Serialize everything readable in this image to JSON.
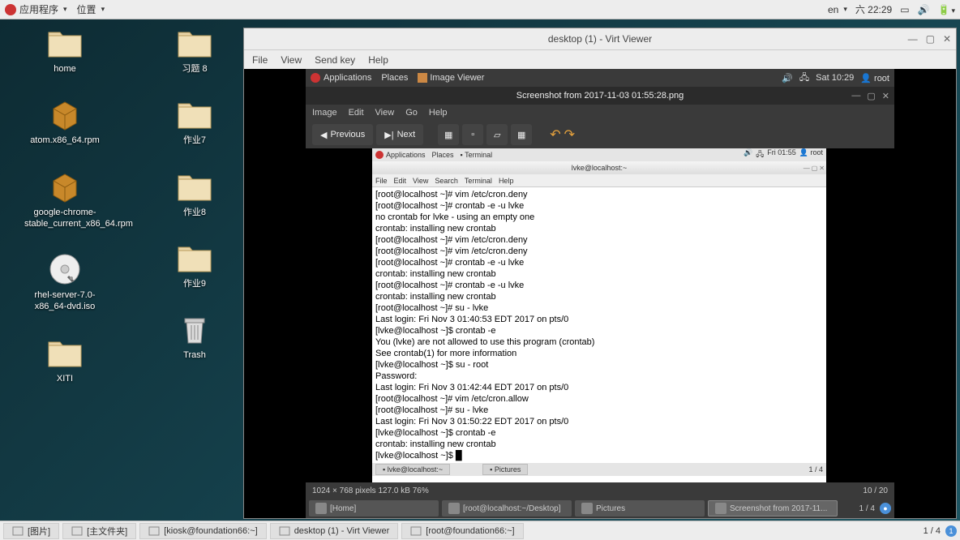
{
  "topbar": {
    "apps": "应用程序",
    "places": "位置",
    "lang": "en",
    "daytime": "六 22:29"
  },
  "desktop_icons": {
    "col1": [
      {
        "label": "home",
        "type": "folder"
      },
      {
        "label": "atom.x86_64.rpm",
        "type": "pkg"
      },
      {
        "label": "google-chrome-stable_current_x86_64.rpm",
        "type": "pkg"
      },
      {
        "label": "rhel-server-7.0-x86_64-dvd.iso",
        "type": "disc"
      },
      {
        "label": "XITI",
        "type": "folder"
      }
    ],
    "col2": [
      {
        "label": "习题  8",
        "type": "folder"
      },
      {
        "label": "作业7",
        "type": "folder"
      },
      {
        "label": "作业8",
        "type": "folder"
      },
      {
        "label": "作业9",
        "type": "folder"
      },
      {
        "label": "Trash",
        "type": "trash"
      }
    ]
  },
  "virt": {
    "title": "desktop (1) - Virt Viewer",
    "menu": [
      "File",
      "View",
      "Send key",
      "Help"
    ]
  },
  "inner": {
    "top": {
      "apps": "Applications",
      "places": "Places",
      "iv": "Image Viewer",
      "time": "Sat 10:29",
      "user": "root"
    },
    "img_title": "Screenshot from 2017-11-03 01:55:28.png",
    "img_menu": [
      "Image",
      "Edit",
      "View",
      "Go",
      "Help"
    ],
    "prev": "Previous",
    "next": "Next",
    "innermost": {
      "top": {
        "apps": "Applications",
        "places": "Places",
        "term": "Terminal",
        "time": "Fri 01:55",
        "user": "root"
      },
      "title": "lvke@localhost:~",
      "menu": [
        "File",
        "Edit",
        "View",
        "Search",
        "Terminal",
        "Help"
      ],
      "term_lines": [
        "[root@localhost ~]# vim /etc/cron.deny",
        "[root@localhost ~]# crontab -e -u lvke",
        "no crontab for lvke - using an empty one",
        "crontab: installing new crontab",
        "[root@localhost ~]# vim /etc/cron.deny",
        "[root@localhost ~]# vim /etc/cron.deny",
        "[root@localhost ~]# crontab -e -u lvke",
        "crontab: installing new crontab",
        "[root@localhost ~]# crontab -e -u lvke",
        "crontab: installing new crontab",
        "[root@localhost ~]# su - lvke",
        "Last login: Fri Nov  3 01:40:53 EDT 2017 on pts/0",
        "[lvke@localhost ~]$ crontab -e",
        "You (lvke) are not allowed to use this program (crontab)",
        "See crontab(1) for more information",
        "[lvke@localhost ~]$ su - root",
        "Password:",
        "Last login: Fri Nov  3 01:42:44 EDT 2017 on pts/0",
        "[root@localhost ~]# vim /etc/cron.allow",
        "[root@localhost ~]# su - lvke",
        "Last login: Fri Nov  3 01:50:22 EDT 2017 on pts/0",
        "[lvke@localhost ~]$ crontab -e",
        "crontab: installing new crontab",
        "[lvke@localhost ~]$ █"
      ],
      "taskbar": {
        "t1": "lvke@localhost:~",
        "t2": "Pictures",
        "counter": "1 / 4"
      }
    },
    "status": {
      "left": "1024 × 768 pixels   127.0 kB   76%",
      "right": "10 / 20"
    },
    "taskbar": [
      {
        "label": "[Home]"
      },
      {
        "label": "[root@localhost:~/Desktop]"
      },
      {
        "label": "Pictures"
      },
      {
        "label": "Screenshot from 2017-11...",
        "active": true
      }
    ],
    "taskbar_counter": "1 / 4"
  },
  "bottom": [
    {
      "label": "[图片]"
    },
    {
      "label": "[主文件夹]"
    },
    {
      "label": "[kiosk@foundation66:~]"
    },
    {
      "label": "desktop (1) - Virt Viewer"
    },
    {
      "label": "[root@foundation66:~]"
    }
  ],
  "bottom_counter": "1 / 4"
}
